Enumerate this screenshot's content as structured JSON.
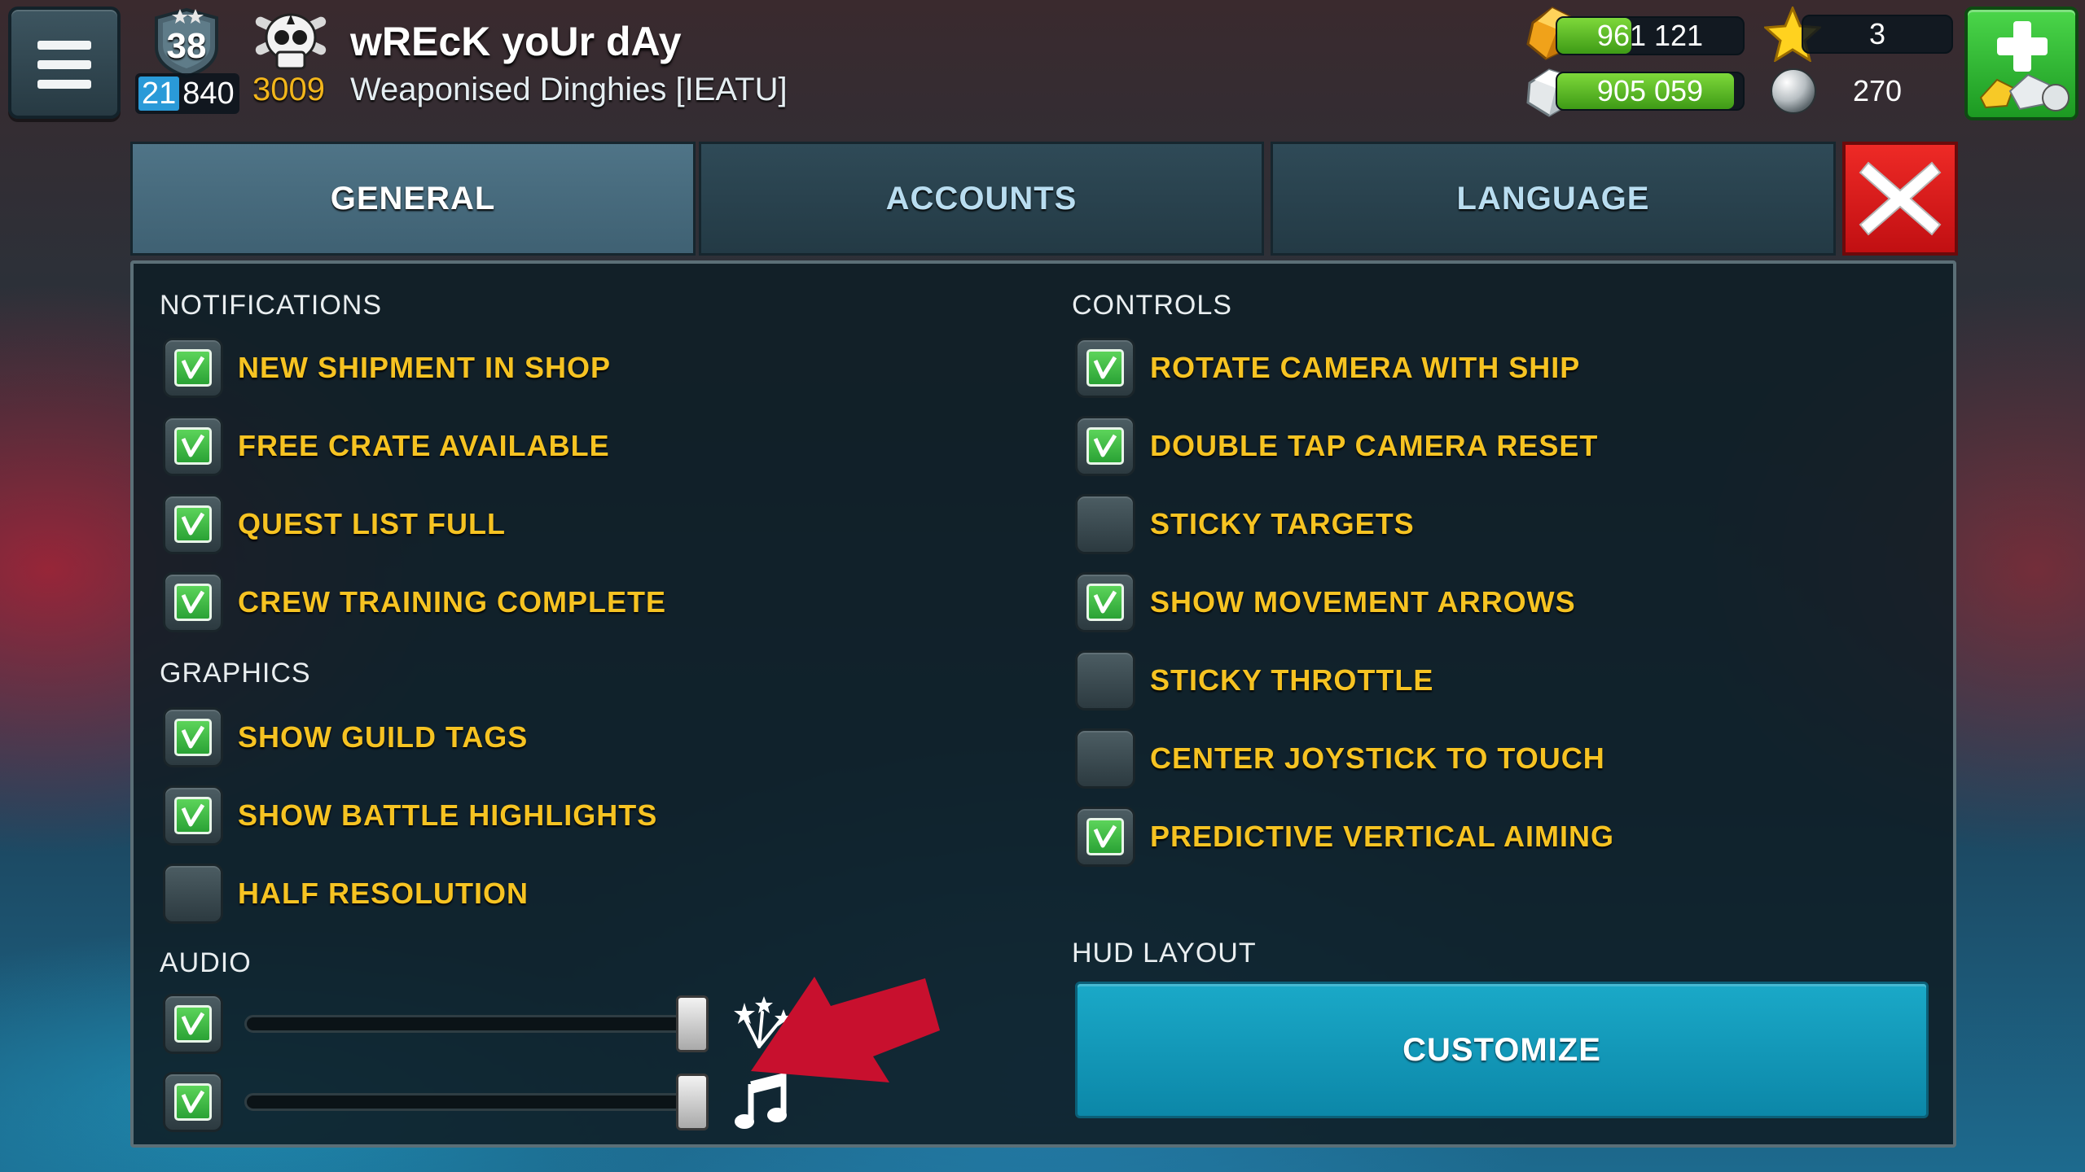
{
  "header": {
    "rank": "38",
    "rank_progress_highlight": "21",
    "rank_progress_rest": "840",
    "skull_score": "3009",
    "player_name": "wREcK yoUr dAy",
    "guild_name": "Weaponised Dinghies [IEATU]",
    "gold": "961 121",
    "silver": "905 059",
    "stars": "3",
    "pearls": "270",
    "gold_fill_fraction": 0.4,
    "silver_fill_fraction": 0.95
  },
  "tabs": [
    {
      "label": "GENERAL",
      "active": true
    },
    {
      "label": "ACCOUNTS",
      "active": false
    },
    {
      "label": "LANGUAGE",
      "active": false
    }
  ],
  "sections": {
    "notifications": {
      "title": "NOTIFICATIONS",
      "items": [
        {
          "label": "NEW SHIPMENT IN SHOP",
          "checked": true
        },
        {
          "label": "FREE CRATE AVAILABLE",
          "checked": true
        },
        {
          "label": "QUEST LIST FULL",
          "checked": true
        },
        {
          "label": "CREW TRAINING COMPLETE",
          "checked": true
        }
      ]
    },
    "graphics": {
      "title": "GRAPHICS",
      "items": [
        {
          "label": "SHOW GUILD TAGS",
          "checked": true
        },
        {
          "label": "SHOW BATTLE HIGHLIGHTS",
          "checked": true
        },
        {
          "label": "HALF RESOLUTION",
          "checked": false
        }
      ]
    },
    "audio": {
      "title": "AUDIO",
      "items": [
        {
          "icon": "sound-effects-icon",
          "checked": true,
          "level": 1.0
        },
        {
          "icon": "music-note-icon",
          "checked": true,
          "level": 1.0
        }
      ]
    },
    "controls": {
      "title": "CONTROLS",
      "items": [
        {
          "label": "ROTATE CAMERA WITH SHIP",
          "checked": true
        },
        {
          "label": "DOUBLE TAP CAMERA RESET",
          "checked": true
        },
        {
          "label": "STICKY TARGETS",
          "checked": false
        },
        {
          "label": "SHOW MOVEMENT ARROWS",
          "checked": true
        },
        {
          "label": "STICKY THROTTLE",
          "checked": false
        },
        {
          "label": "CENTER JOYSTICK TO TOUCH",
          "checked": false
        },
        {
          "label": "PREDICTIVE VERTICAL AIMING",
          "checked": true
        }
      ]
    },
    "hud_layout": {
      "title": "HUD LAYOUT",
      "button_label": "CUSTOMIZE"
    }
  },
  "colors": {
    "option_text": "#f6c322",
    "check_green": "#3fbf45",
    "annotation_arrow": "#c8102e",
    "customize_button": "#1499bb",
    "close_button": "#e01d1d"
  }
}
